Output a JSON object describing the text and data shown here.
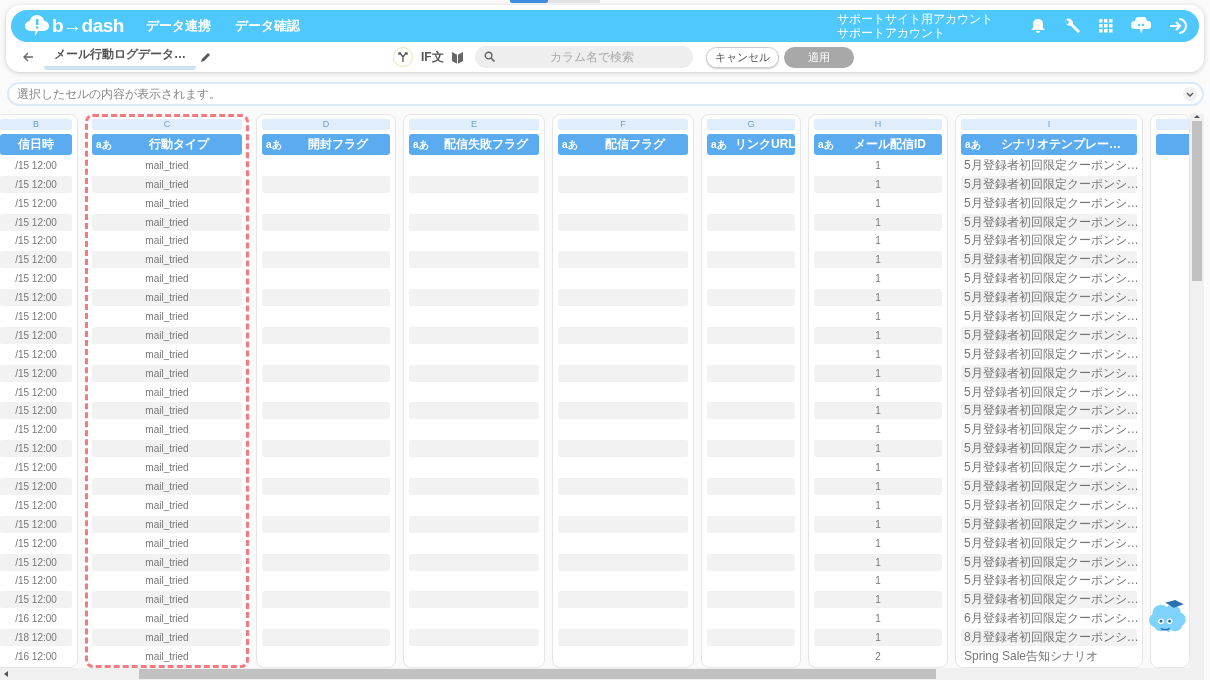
{
  "app": {
    "logo": "b→dash",
    "nav": [
      {
        "label": "データ連携"
      },
      {
        "label": "データ確認"
      }
    ],
    "account": {
      "site": "サポートサイト用アカウント",
      "name": "サポートアカウント"
    }
  },
  "toolbar": {
    "title": "メール行動ログデータ…",
    "if_label": "IF文",
    "search": {
      "placeholder": "カラム名で検索"
    },
    "cancel": {
      "label": "キャンセル"
    },
    "apply": {
      "label": "適用",
      "disabled": true
    }
  },
  "cell_view": {
    "placeholder": "選択したセルの内容が表示されます。"
  },
  "columns": [
    {
      "letter": "B",
      "title": "信日時",
      "badge": false,
      "selected": false,
      "cells": [
        "/15 12:00",
        "/15 12:00",
        "/15 12:00",
        "/15 12:00",
        "/15 12:00",
        "/15 12:00",
        "/15 12:00",
        "/15 12:00",
        "/15 12:00",
        "/15 12:00",
        "/15 12:00",
        "/15 12:00",
        "/15 12:00",
        "/15 12:00",
        "/15 12:00",
        "/15 12:00",
        "/15 12:00",
        "/15 12:00",
        "/15 12:00",
        "/15 12:00",
        "/15 12:00",
        "/15 12:00",
        "/15 12:00",
        "/15 12:00",
        "/16 12:00",
        "/18 12:00",
        "/16 12:00"
      ]
    },
    {
      "letter": "C",
      "title": "行動タイプ",
      "badge": "aあ",
      "selected": true,
      "cells": [
        "mail_tried",
        "mail_tried",
        "mail_tried",
        "mail_tried",
        "mail_tried",
        "mail_tried",
        "mail_tried",
        "mail_tried",
        "mail_tried",
        "mail_tried",
        "mail_tried",
        "mail_tried",
        "mail_tried",
        "mail_tried",
        "mail_tried",
        "mail_tried",
        "mail_tried",
        "mail_tried",
        "mail_tried",
        "mail_tried",
        "mail_tried",
        "mail_tried",
        "mail_tried",
        "mail_tried",
        "mail_tried",
        "mail_tried",
        "mail_tried"
      ]
    },
    {
      "letter": "D",
      "title": "開封フラグ",
      "badge": "aあ",
      "selected": false
    },
    {
      "letter": "E",
      "title": "配信失敗フラグ",
      "badge": "aあ",
      "selected": false
    },
    {
      "letter": "F",
      "title": "配信フラグ",
      "badge": "aあ",
      "selected": false
    },
    {
      "letter": "G",
      "title": "リンクURL",
      "badge": "aあ",
      "selected": false
    },
    {
      "letter": "H",
      "title": "メール配信ID",
      "badge": "aあ",
      "selected": false,
      "cells": [
        "1",
        "1",
        "1",
        "1",
        "1",
        "1",
        "1",
        "1",
        "1",
        "1",
        "1",
        "1",
        "1",
        "1",
        "1",
        "1",
        "1",
        "1",
        "1",
        "1",
        "1",
        "1",
        "1",
        "1",
        "1",
        "1",
        "2"
      ]
    },
    {
      "letter": "I",
      "title": "シナリオテンプレー…",
      "badge": "aあ",
      "selected": false,
      "cells": [
        "5月登録者初回限定クーポンシ…",
        "5月登録者初回限定クーポンシ…",
        "5月登録者初回限定クーポンシ…",
        "5月登録者初回限定クーポンシ…",
        "5月登録者初回限定クーポンシ…",
        "5月登録者初回限定クーポンシ…",
        "5月登録者初回限定クーポンシ…",
        "5月登録者初回限定クーポンシ…",
        "5月登録者初回限定クーポンシ…",
        "5月登録者初回限定クーポンシ…",
        "5月登録者初回限定クーポンシ…",
        "5月登録者初回限定クーポンシ…",
        "5月登録者初回限定クーポンシ…",
        "5月登録者初回限定クーポンシ…",
        "5月登録者初回限定クーポンシ…",
        "5月登録者初回限定クーポンシ…",
        "5月登録者初回限定クーポンシ…",
        "5月登録者初回限定クーポンシ…",
        "5月登録者初回限定クーポンシ…",
        "5月登録者初回限定クーポンシ…",
        "5月登録者初回限定クーポンシ…",
        "5月登録者初回限定クーポンシ…",
        "5月登録者初回限定クーポンシ…",
        "5月登録者初回限定クーポンシ…",
        "6月登録者初回限定クーポンシ…",
        "8月登録者初回限定クーポンシ…",
        "Spring Sale告知シナリオ"
      ]
    }
  ]
}
